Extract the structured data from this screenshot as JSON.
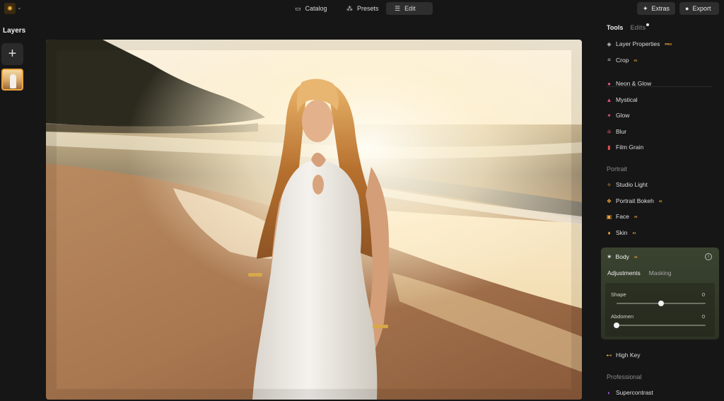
{
  "nav": {
    "catalog": "Catalog",
    "presets": "Presets",
    "edit": "Edit",
    "extras": "Extras",
    "export": "Export",
    "active_tab": "edit"
  },
  "layers": {
    "title": "Layers"
  },
  "tools_panel": {
    "tab_tools": "Tools",
    "tab_edits": "Edits",
    "items_top": [
      {
        "label": "Layer Properties",
        "pro": "PRO",
        "icon": "layers-icon"
      },
      {
        "label": "Crop",
        "pro": "AI",
        "icon": "crop-icon"
      }
    ],
    "items_creative": [
      {
        "label": "Neon & Glow",
        "icon": "neon-icon"
      },
      {
        "label": "Mystical",
        "icon": "mystical-icon"
      },
      {
        "label": "Glow",
        "icon": "glow-icon"
      },
      {
        "label": "Blur",
        "icon": "blur-icon"
      },
      {
        "label": "Film Grain",
        "icon": "film-grain-icon"
      }
    ],
    "section_portrait": "Portrait",
    "items_portrait": [
      {
        "label": "Studio Light",
        "icon": "studio-light-icon"
      },
      {
        "label": "Portrait Bokeh",
        "pro": "AI",
        "icon": "bokeh-icon"
      },
      {
        "label": "Face",
        "pro": "AI",
        "icon": "face-icon"
      },
      {
        "label": "Skin",
        "pro": "AI",
        "icon": "skin-icon"
      }
    ],
    "body_tool": {
      "label": "Body",
      "pro": "AI",
      "subtab_adjustments": "Adjustments",
      "subtab_masking": "Masking",
      "active_subtab": "adjustments",
      "shape_label": "Shape",
      "shape_value": "0",
      "shape_position": 0.5,
      "abdomen_label": "Abdomen",
      "abdomen_value": "0",
      "abdomen_position": 0.0
    },
    "item_high_key": {
      "label": "High Key",
      "icon": "high-key-icon"
    },
    "section_professional": "Professional",
    "item_supercontrast": {
      "label": "Supercontrast",
      "icon": "supercontrast-icon"
    }
  },
  "colors": {
    "accent": "#f0a53c",
    "panel_bg": "#161616",
    "body_card": "#3a4330"
  }
}
